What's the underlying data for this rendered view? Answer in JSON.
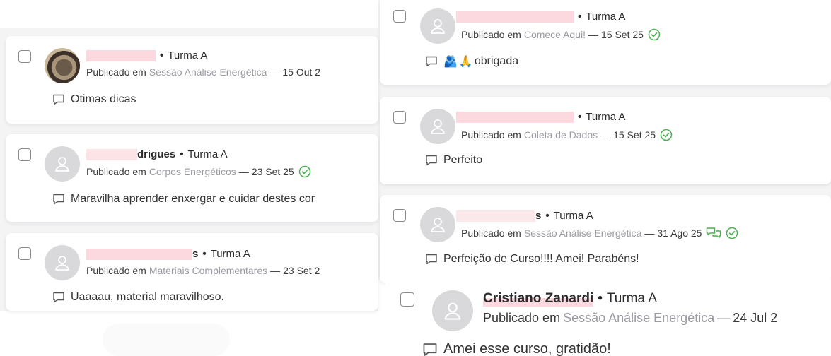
{
  "class_label": "Turma A",
  "published_prefix": "Publicado em",
  "colors": {
    "accent_green": "#4caf50",
    "lesson_grey": "#9a9aa3",
    "redaction": "#fcd9de"
  },
  "comments": [
    {
      "name_visible": "",
      "lesson": "Sessão Análise Energética",
      "date": "15 Out 2",
      "comment": "Otimas dicas"
    },
    {
      "name_visible": "drigues",
      "name_hidden_part": "",
      "lesson": "Corpos Energéticos",
      "date": "23 Set 25",
      "comment": "Maravilha aprender enxergar e cuidar destes cor"
    },
    {
      "name_visible": "s",
      "lesson": "Materiais Complementares",
      "date": "23 Set 2",
      "comment": "Uaaaau, material maravilhoso."
    },
    {
      "name_visible": "",
      "lesson": "Comece Aqui!",
      "date": "15 Set 25",
      "comment": "obrigada"
    },
    {
      "name_visible": "",
      "lesson": "Coleta de Dados",
      "date": "15 Set 25",
      "comment": "Perfeito"
    },
    {
      "name_visible": "s",
      "lesson": "Sessão Análise Energética",
      "date": "31 Ago 25",
      "comment": "Perfeição de Curso!!!! Amei! Parabéns!"
    },
    {
      "name_visible": "Cristiano Zanardi",
      "lesson": "Sessão Análise Energética",
      "date": "24 Jul 2",
      "comment": "Amei esse curso, gratidão!"
    }
  ],
  "emojis": {
    "hug": "🫂",
    "pray": "🙏"
  }
}
